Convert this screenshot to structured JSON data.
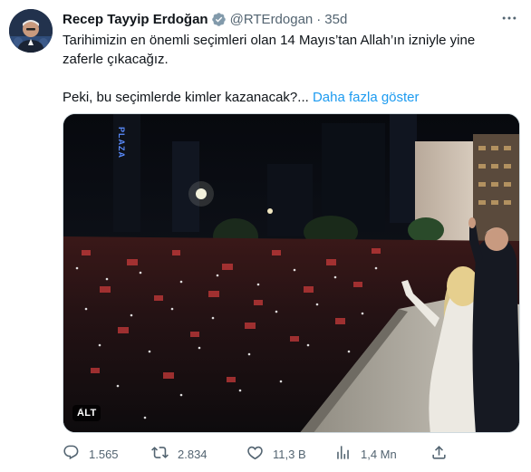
{
  "author": {
    "name": "Recep Tayyip Erdoğan",
    "handle": "@RTErdogan",
    "separator": "·",
    "time": "35d"
  },
  "tweet": {
    "line1": "Tarihimizin en önemli seçimleri olan 14 Mayıs’tan Allah’ın izniyle yine zaferle çıkacağız.",
    "line2": "Peki, bu seçimlerde kimler kazanacak?...",
    "show_more": "Daha fazla göster"
  },
  "media": {
    "alt_badge": "ALT",
    "sign_text": "PLAZA"
  },
  "actions": {
    "replies": "1.565",
    "retweets": "2.834",
    "likes": "11,3 B",
    "views": "1,4 Mn"
  },
  "colors": {
    "link": "#1d9bf0",
    "secondary": "#536471",
    "verified": "#829aab"
  },
  "icons": [
    "verified-badge-icon",
    "more-icon",
    "reply-icon",
    "retweet-icon",
    "like-icon",
    "views-icon",
    "share-icon"
  ]
}
